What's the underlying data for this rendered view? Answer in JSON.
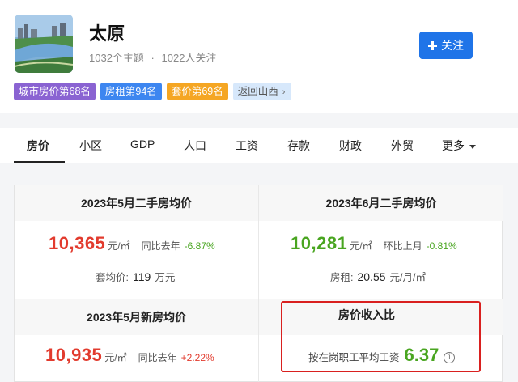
{
  "city": {
    "name": "太原",
    "topics": "1032个主题",
    "followers": "1022人关注",
    "follow_label": "关注"
  },
  "tags": [
    {
      "label": "城市房价第68名",
      "color": "#8a63d2"
    },
    {
      "label": "房租第94名",
      "color": "#3d86f0"
    },
    {
      "label": "套价第69名",
      "color": "#f5a623"
    },
    {
      "label": "返回山西",
      "color": "#d7e8fb"
    }
  ],
  "tabs": [
    "房价",
    "小区",
    "GDP",
    "人口",
    "工资",
    "存款",
    "财政",
    "外贸",
    "更多"
  ],
  "cards": {
    "secondhand_may": {
      "title": "2023年5月二手房均价",
      "price": "10,365",
      "unit": "元/㎡",
      "cmp_label": "同比去年",
      "cmp_value": "-6.87%",
      "extra_label": "套均价:",
      "extra_value": "119",
      "extra_unit": "万元"
    },
    "secondhand_june": {
      "title": "2023年6月二手房均价",
      "price": "10,281",
      "unit": "元/㎡",
      "cmp_label": "环比上月",
      "cmp_value": "-0.81%",
      "extra_label": "房租:",
      "extra_value": "20.55",
      "extra_unit": "元/月/㎡"
    },
    "new_may": {
      "title": "2023年5月新房均价",
      "price": "10,935",
      "unit": "元/㎡",
      "cmp_label": "同比去年",
      "cmp_value": "+2.22%"
    },
    "ratio": {
      "title": "房价收入比",
      "label": "按在岗职工平均工资",
      "value": "6.37"
    }
  },
  "colors": {
    "accent": "#1f74e8",
    "price_up": "#e23b2e",
    "price_down": "#49a520",
    "highlight": "#d9201f"
  }
}
